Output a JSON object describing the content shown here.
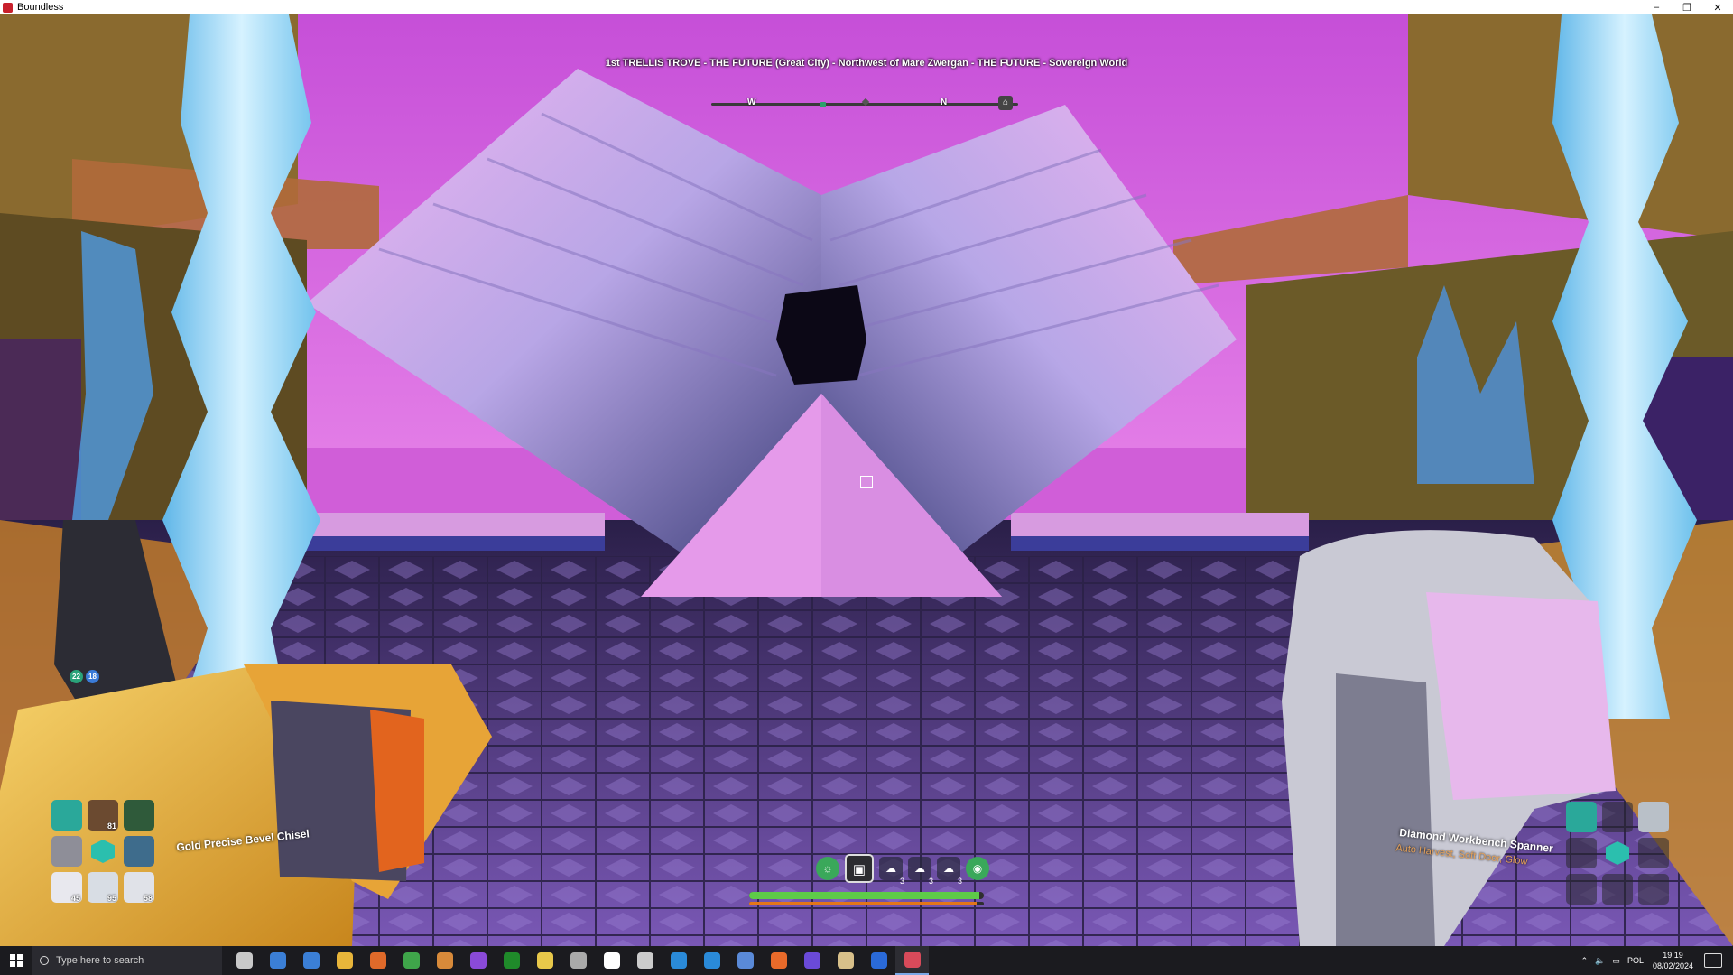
{
  "window": {
    "title": "Boundless",
    "controls": [
      "–",
      "❐",
      "✕"
    ]
  },
  "hud": {
    "location": "1st TRELLIS TROVE - THE FUTURE (Great City) - Northwest of Mare Zwergan - THE FUTURE - Sovereign World",
    "compass": {
      "west": "W",
      "north": "N"
    },
    "coords": [
      "22",
      "18"
    ],
    "left_tool": {
      "name": "Gold Precise Bevel Chisel",
      "slots": [
        {
          "icon": "hammer-icon",
          "count": "",
          "active": true
        },
        {
          "icon": "food-icon",
          "count": "81"
        },
        {
          "icon": "grapple-icon",
          "count": ""
        },
        {
          "icon": "hammer-icon",
          "count": ""
        },
        {
          "icon": "hexagon-icon",
          "count": ""
        },
        {
          "icon": "pickaxe-icon",
          "count": ""
        },
        {
          "icon": "block-icon",
          "count": "45"
        },
        {
          "icon": "block-icon",
          "count": "95"
        },
        {
          "icon": "block-icon",
          "count": "58"
        }
      ]
    },
    "right_tool": {
      "name": "Diamond Workbench Spanner",
      "sub": "Auto Harvest, Soft Door, Glow",
      "slots": [
        {
          "icon": "spanner-icon",
          "count": "",
          "active": true
        },
        {
          "icon": "empty-slot",
          "count": ""
        },
        {
          "icon": "block-icon",
          "count": ""
        },
        {
          "icon": "empty-slot",
          "count": ""
        },
        {
          "icon": "hexagon-icon",
          "count": ""
        },
        {
          "icon": "empty-slot",
          "count": ""
        },
        {
          "icon": "empty-slot",
          "count": ""
        },
        {
          "icon": "empty-slot",
          "count": ""
        },
        {
          "icon": "empty-slot",
          "count": ""
        }
      ]
    },
    "status_icons": [
      {
        "icon": "sun-icon",
        "count": ""
      },
      {
        "icon": "save-icon",
        "count": ""
      },
      {
        "icon": "buff-icon",
        "count": "3"
      },
      {
        "icon": "buff-icon",
        "count": "3"
      },
      {
        "icon": "buff-icon",
        "count": "3"
      },
      {
        "icon": "bag-icon",
        "count": ""
      }
    ],
    "health_fraction": 0.98,
    "energy_fraction": 0.97
  },
  "taskbar": {
    "search_placeholder": "Type here to search",
    "apps": [
      "task-view",
      "calculator",
      "store",
      "explorer",
      "app",
      "chrome",
      "app",
      "app",
      "xbox",
      "app",
      "app",
      "app",
      "app",
      "app",
      "app",
      "steam",
      "firefox",
      "app",
      "app",
      "steam",
      "boundless"
    ],
    "lang": "POL",
    "time": "19:19",
    "date": "08/02/2024"
  },
  "colors": {
    "sky": "#d35ee0",
    "pyramid": "#e39be9",
    "floor": "#5b3f8f",
    "gold": "#e0a92a",
    "crystal": "#8fd2f0"
  }
}
